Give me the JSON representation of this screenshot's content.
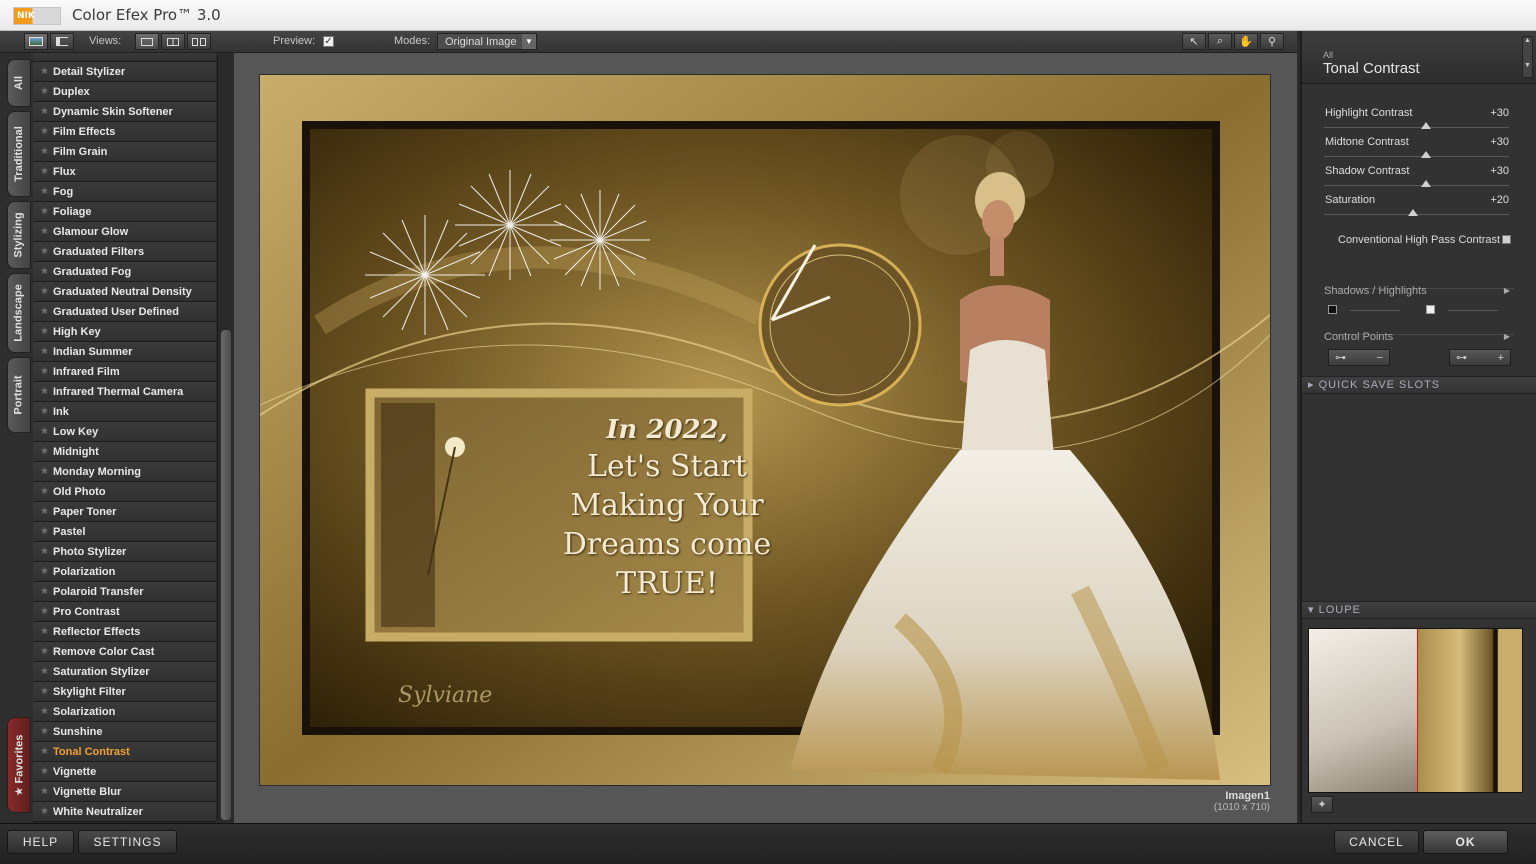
{
  "app": {
    "title": "Color Efex Pro™ 3.0",
    "logo_text": "NIK"
  },
  "toolbar": {
    "views_label": "Views:",
    "preview_label": "Preview:",
    "preview_checked": true,
    "modes_label": "Modes:",
    "mode_value": "Original Image"
  },
  "tabs": [
    "All",
    "Traditional",
    "Stylizing",
    "Landscape",
    "Portrait",
    "Favorites"
  ],
  "filters": [
    "Detail Stylizer",
    "Duplex",
    "Dynamic Skin Softener",
    "Film Effects",
    "Film Grain",
    "Flux",
    "Fog",
    "Foliage",
    "Glamour Glow",
    "Graduated Filters",
    "Graduated Fog",
    "Graduated Neutral Density",
    "Graduated User Defined",
    "High Key",
    "Indian Summer",
    "Infrared Film",
    "Infrared Thermal Camera",
    "Ink",
    "Low Key",
    "Midnight",
    "Monday Morning",
    "Old Photo",
    "Paper Toner",
    "Pastel",
    "Photo Stylizer",
    "Polarization",
    "Polaroid Transfer",
    "Pro Contrast",
    "Reflector Effects",
    "Remove Color Cast",
    "Saturation Stylizer",
    "Skylight Filter",
    "Solarization",
    "Sunshine",
    "Tonal Contrast",
    "Vignette",
    "Vignette Blur",
    "White Neutralizer"
  ],
  "selected_filter": "Tonal Contrast",
  "image": {
    "name": "Imagen1",
    "dimensions": "(1010 x 710)",
    "text_line1": "In 2022,",
    "text_line2": "Let's Start",
    "text_line3": "Making Your",
    "text_line4": "Dreams come",
    "text_line5": "TRUE!",
    "signature": "Sylviane"
  },
  "panel": {
    "category": "All",
    "filter_name": "Tonal Contrast",
    "sliders": [
      {
        "label": "Highlight Contrast",
        "value": "+30",
        "level": 0.55
      },
      {
        "label": "Midtone Contrast",
        "value": "+30",
        "level": 0.55
      },
      {
        "label": "Shadow Contrast",
        "value": "+30",
        "level": 0.55
      },
      {
        "label": "Saturation",
        "value": "+20",
        "level": 0.48
      }
    ],
    "checkbox_label": "Conventional High Pass Contrast",
    "shadows_highlights": "Shadows / Highlights",
    "control_points": "Control Points",
    "quick_save": "QUICK SAVE SLOTS",
    "loupe": "LOUPE"
  },
  "buttons": {
    "help": "HELP",
    "settings": "SETTINGS",
    "cancel": "CANCEL",
    "ok": "OK"
  }
}
